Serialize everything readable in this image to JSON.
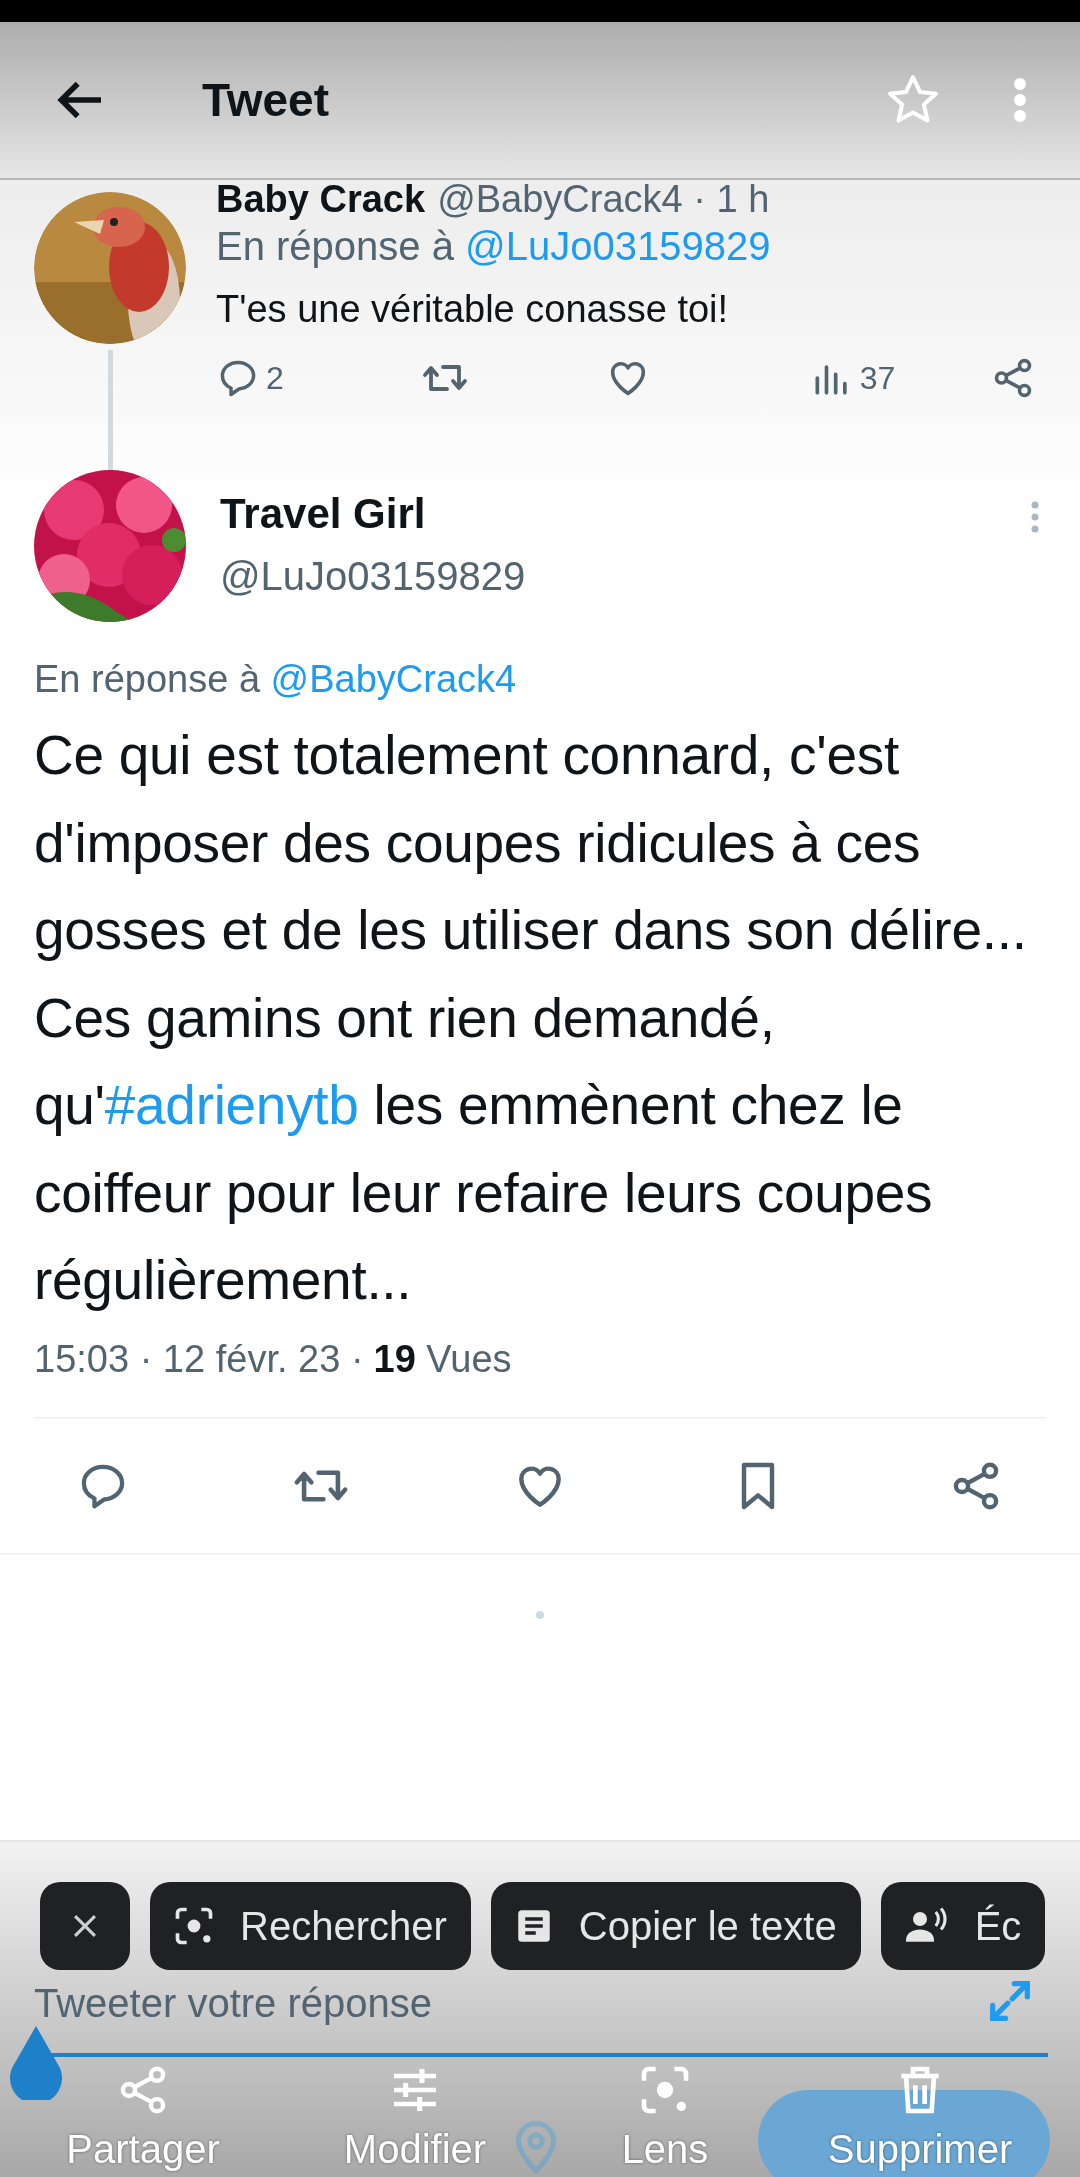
{
  "header": {
    "title": "Tweet",
    "starred": false
  },
  "parent_tweet": {
    "name": "Baby Crack",
    "handle": "@BabyCrack4 · 1 h",
    "reply_prefix": "En réponse à",
    "reply_to": "@LuJo03159829",
    "text": "T'es une véritable conasse toi!",
    "replies": "2",
    "views": "37"
  },
  "main_tweet": {
    "name": "Travel Girl",
    "handle": "@LuJo03159829",
    "reply_prefix": "En réponse à",
    "reply_to": "@BabyCrack4",
    "text_parts": [
      {
        "kind": "text",
        "text": "Ce qui est totalement connard, c'est d'imposer des coupes ridicules à ces gosses et de les utiliser dans son délire... Ces gamins ont rien demandé, qu'"
      },
      {
        "kind": "hashtag",
        "text": "#adrienytb"
      },
      {
        "kind": "text",
        "text": " les emmènent chez le coiffeur pour leur refaire leurs coupes régulièrement..."
      }
    ],
    "meta": "15:03 · 12 févr. 23 ·",
    "views_count": "19",
    "views_label": "Vues"
  },
  "composer": {
    "placeholder": "Tweeter votre réponse"
  },
  "selection_menu": [
    {
      "kind": "close"
    },
    {
      "kind": "lens",
      "label": "Rechercher"
    },
    {
      "kind": "copy",
      "label": "Copier le texte"
    },
    {
      "kind": "listen",
      "label": "Éc"
    }
  ],
  "screenshot_actions": [
    {
      "kind": "share",
      "label": "Partager"
    },
    {
      "kind": "edit",
      "label": "Modifier"
    },
    {
      "kind": "lens",
      "label": "Lens"
    },
    {
      "kind": "delete",
      "label": "Supprimer"
    }
  ]
}
